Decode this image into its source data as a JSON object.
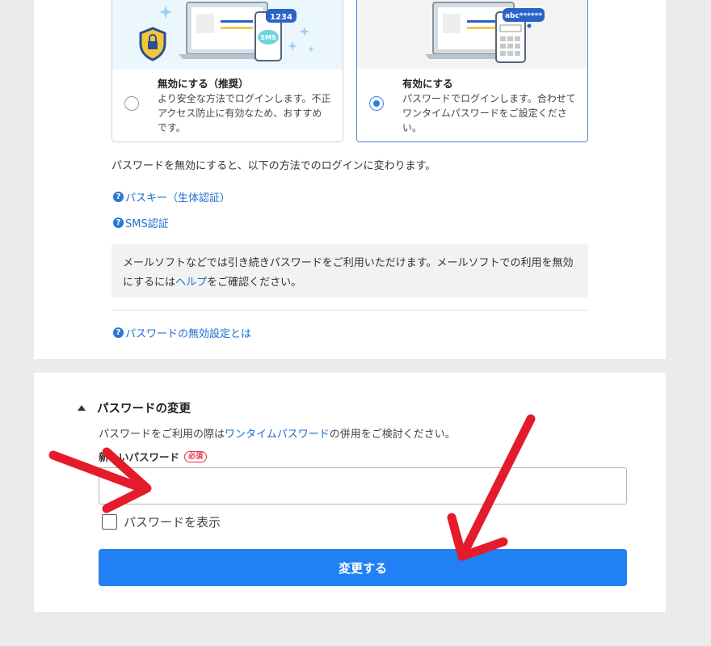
{
  "login_setting": {
    "options": [
      {
        "title": "無効にする（推奨）",
        "desc": "より安全な方法でログインします。不正アクセス防止に有効なため、おすすめです。",
        "illustration": {
          "otp_label": "1234",
          "sms_label": "SMS"
        }
      },
      {
        "title": "有効にする",
        "desc": "パスワードでログインします。合わせてワンタイムパスワードをご設定ください。",
        "illustration": {
          "otp_label": "abc******"
        }
      }
    ],
    "selected_index": 1,
    "note": "パスワードを無効にすると、以下の方法でのログインに変わります。",
    "links": {
      "passkey": "パスキー（生体認証）",
      "sms": "SMS認証",
      "about": "パスワードの無効設定とは"
    },
    "info_box": {
      "before": "メールソフトなどでは引き続きパスワードをご利用いただけます。メールソフトでの利用を無効にするには",
      "link": "ヘルプ",
      "after": "をご確認ください。"
    },
    "help_icon": "?"
  },
  "password_change": {
    "title": "パスワードの変更",
    "note_before": "パスワードをご利用の際は",
    "note_link": "ワンタイムパスワード",
    "note_after": "の併用をご検討ください。",
    "field_label": "新しいパスワード",
    "required_badge": "必須",
    "input_value": "",
    "show_password_label": "パスワードを表示",
    "show_password_checked": false,
    "submit_label": "変更する"
  },
  "colors": {
    "accent": "#2180f3",
    "link": "#1a6fd1",
    "annotation_arrow": "#e41b2b",
    "required": "#e0323c"
  },
  "icons": [
    "lock-shield-icon",
    "help-icon",
    "triangle-up-icon",
    "annotation-arrow-icon"
  ]
}
